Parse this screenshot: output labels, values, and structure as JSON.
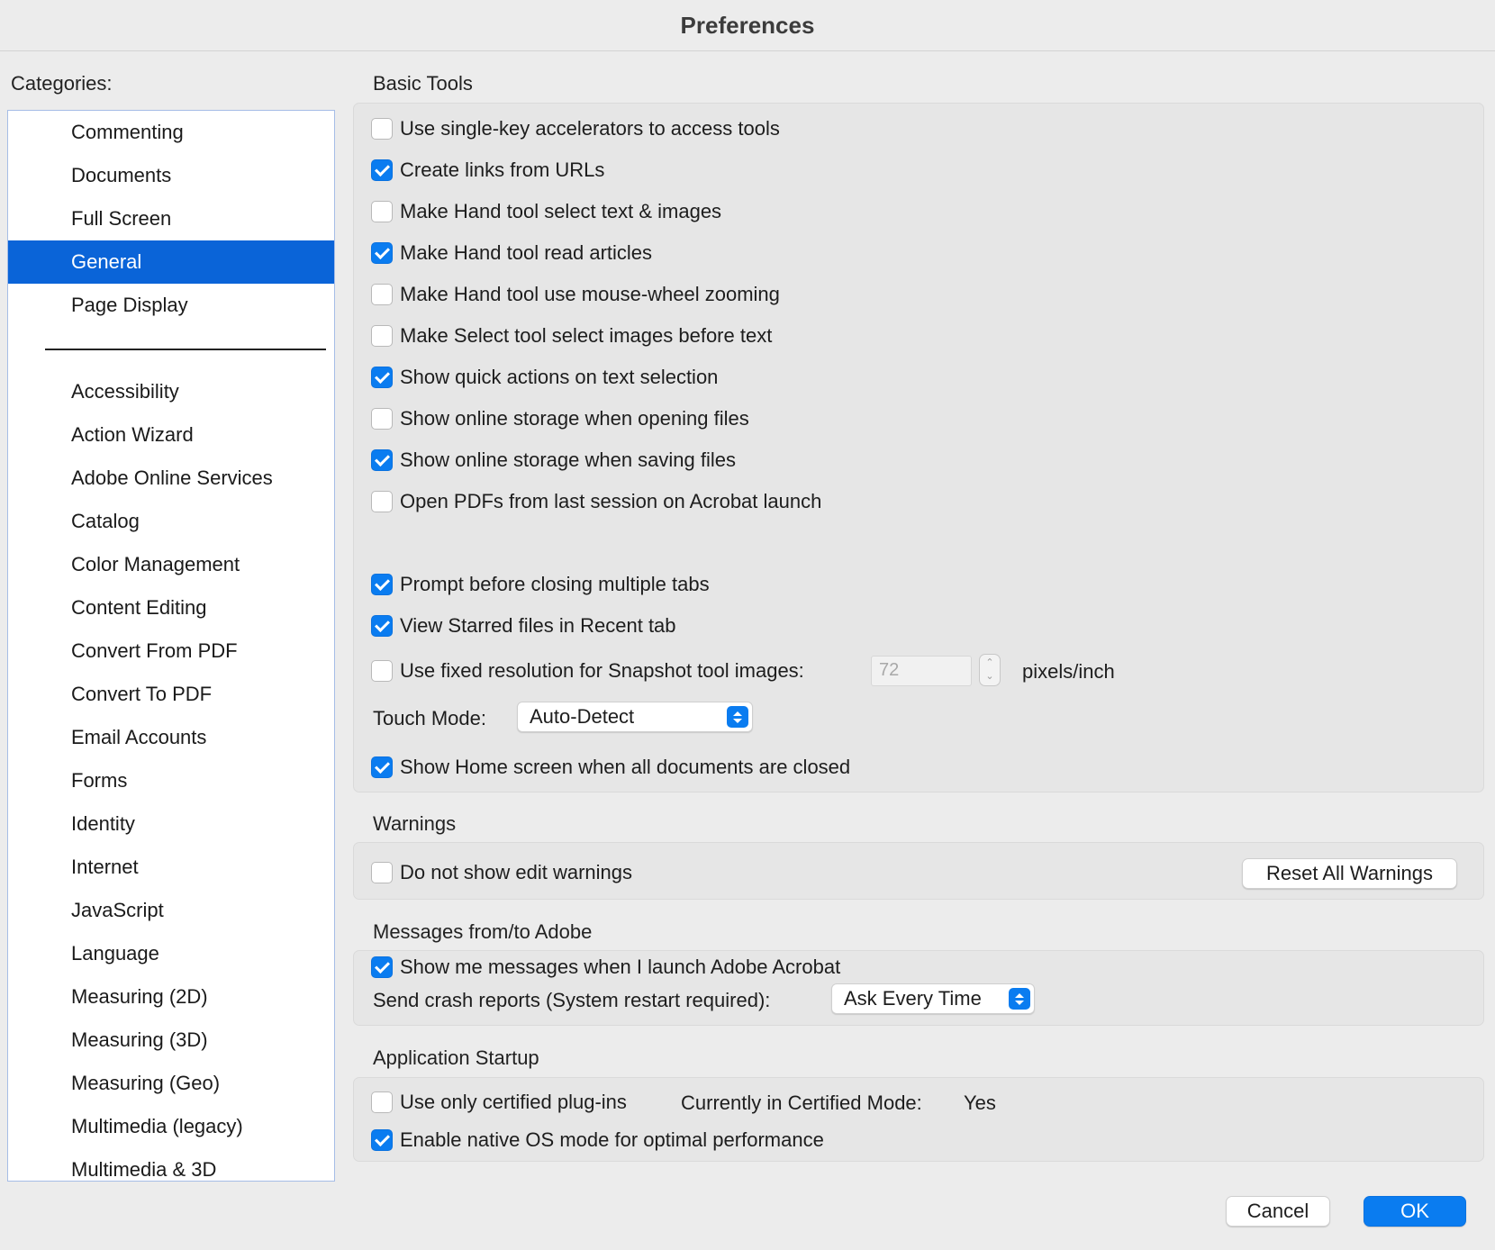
{
  "window": {
    "title": "Preferences"
  },
  "sidebar": {
    "label": "Categories:",
    "selected": "General",
    "items": [
      "Commenting",
      "Documents",
      "Full Screen",
      "General",
      "Page Display",
      "Accessibility",
      "Action Wizard",
      "Adobe Online Services",
      "Catalog",
      "Color Management",
      "Content Editing",
      "Convert From PDF",
      "Convert To PDF",
      "Email Accounts",
      "Forms",
      "Identity",
      "Internet",
      "JavaScript",
      "Language",
      "Measuring (2D)",
      "Measuring (3D)",
      "Measuring (Geo)",
      "Multimedia (legacy)",
      "Multimedia & 3D"
    ]
  },
  "basic_tools": {
    "title": "Basic Tools",
    "options": [
      {
        "label": "Use single-key accelerators to access tools",
        "checked": false
      },
      {
        "label": "Create links from URLs",
        "checked": true
      },
      {
        "label": "Make Hand tool select text & images",
        "checked": false
      },
      {
        "label": "Make Hand tool read articles",
        "checked": true
      },
      {
        "label": "Make Hand tool use mouse-wheel zooming",
        "checked": false
      },
      {
        "label": "Make Select tool select images before text",
        "checked": false
      },
      {
        "label": "Show quick actions on text selection",
        "checked": true
      },
      {
        "label": "Show online storage when opening files",
        "checked": false
      },
      {
        "label": "Show online storage when saving files",
        "checked": true
      },
      {
        "label": "Open PDFs from last session on Acrobat launch",
        "checked": false
      },
      {
        "label": "Prompt before closing multiple tabs",
        "checked": true
      },
      {
        "label": "View Starred files in Recent tab",
        "checked": true
      }
    ],
    "snapshot": {
      "label": "Use fixed resolution for Snapshot tool images:",
      "checked": false,
      "value": "72",
      "unit": "pixels/inch"
    },
    "touch_mode": {
      "label": "Touch Mode:",
      "value": "Auto-Detect"
    },
    "home_screen": {
      "label": "Show Home screen when all documents are closed",
      "checked": true
    }
  },
  "warnings": {
    "title": "Warnings",
    "edit_warnings": {
      "label": "Do not show edit warnings",
      "checked": false
    },
    "reset_button": "Reset All Warnings"
  },
  "messages": {
    "title": "Messages from/to Adobe",
    "show_messages": {
      "label": "Show me messages when I launch Adobe Acrobat",
      "checked": true
    },
    "crash_reports": {
      "label": "Send crash reports (System restart required):",
      "value": "Ask Every Time"
    }
  },
  "startup": {
    "title": "Application Startup",
    "certified_plugins": {
      "label": "Use only certified plug-ins",
      "checked": false
    },
    "certified_mode_label": "Currently in Certified Mode:",
    "certified_mode_value": "Yes",
    "native_os": {
      "label": "Enable native OS mode for optimal performance",
      "checked": true
    }
  },
  "footer": {
    "cancel": "Cancel",
    "ok": "OK"
  },
  "colors": {
    "accent": "#0a7cf0",
    "selection": "#0a64d8",
    "panel": "#e6e6e6",
    "background": "#ececec"
  }
}
